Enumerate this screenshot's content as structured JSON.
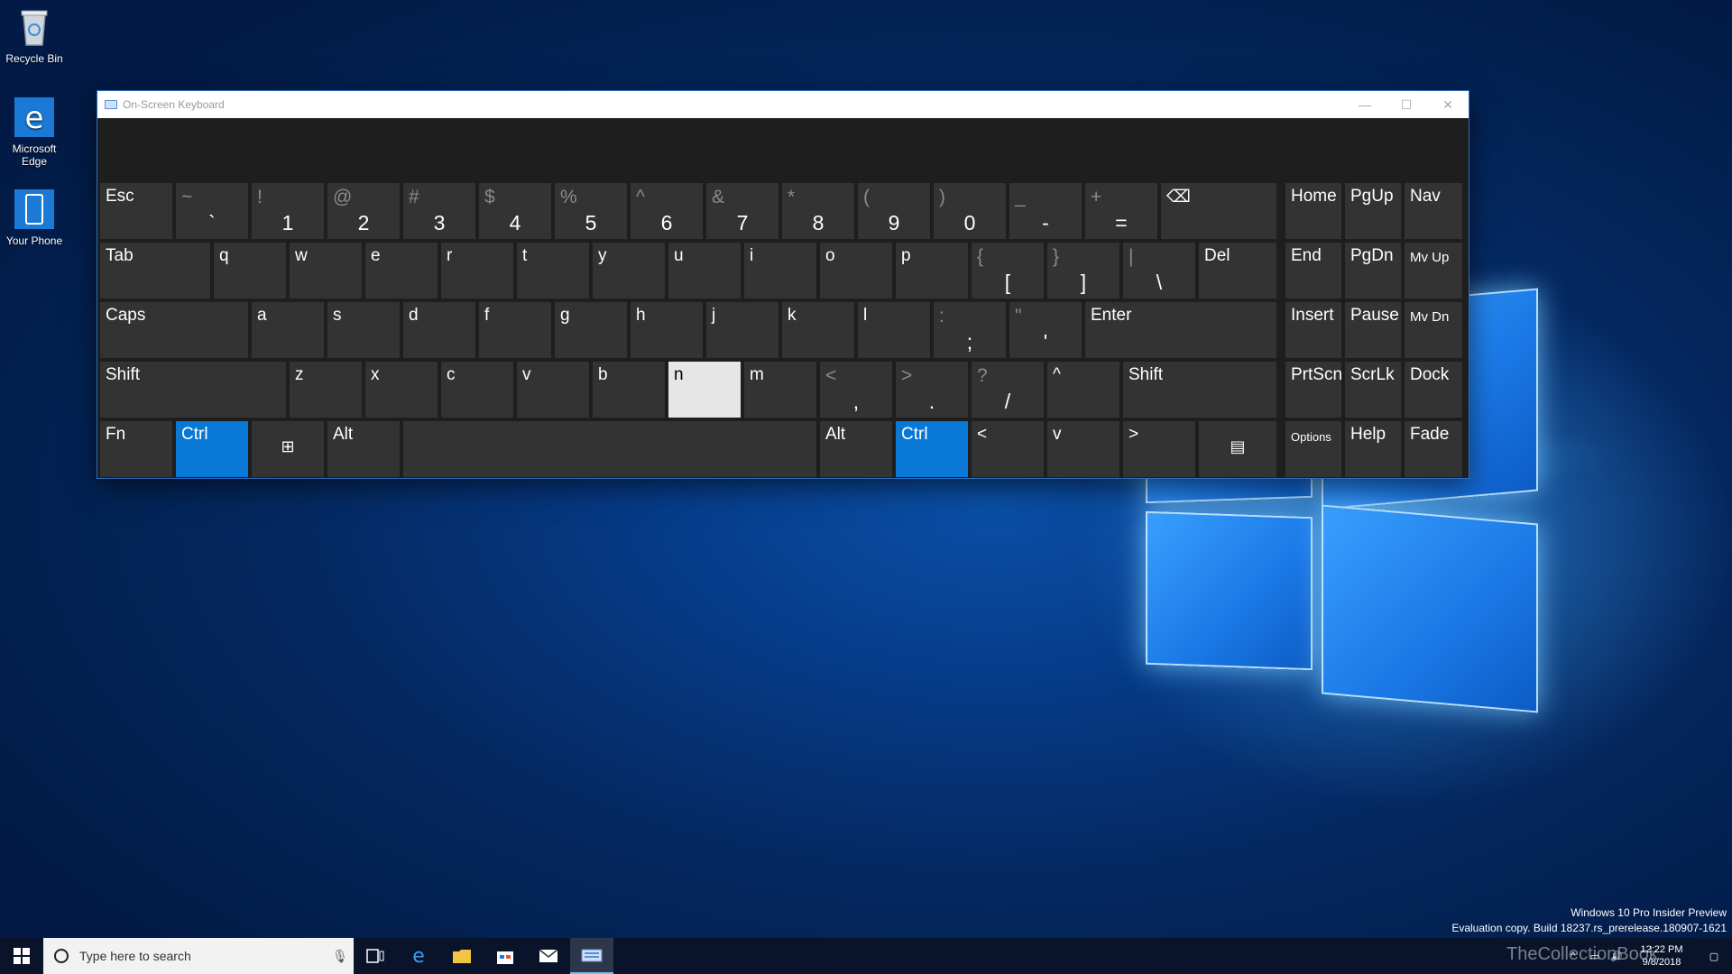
{
  "desktop": {
    "icons": [
      {
        "label": "Recycle Bin",
        "icon": "recycle-bin-icon"
      },
      {
        "label": "Microsoft Edge",
        "icon": "edge-icon"
      },
      {
        "label": "Your Phone",
        "icon": "phone-icon"
      }
    ]
  },
  "osk": {
    "title": "On-Screen Keyboard",
    "controls": {
      "minimize": "—",
      "maximize": "☐",
      "close": "✕"
    },
    "rows": [
      [
        {
          "lbl": "Esc"
        },
        {
          "top": "~",
          "bot": "`"
        },
        {
          "top": "!",
          "bot": "1"
        },
        {
          "top": "@",
          "bot": "2"
        },
        {
          "top": "#",
          "bot": "3"
        },
        {
          "top": "$",
          "bot": "4"
        },
        {
          "top": "%",
          "bot": "5"
        },
        {
          "top": "^",
          "bot": "6"
        },
        {
          "top": "&",
          "bot": "7"
        },
        {
          "top": "*",
          "bot": "8"
        },
        {
          "top": "(",
          "bot": "9"
        },
        {
          "top": ")",
          "bot": "0"
        },
        {
          "top": "_",
          "bot": "-"
        },
        {
          "top": "+",
          "bot": "="
        },
        {
          "lbl": "⌫",
          "icon": "backspace-icon"
        },
        {
          "lbl": "Home"
        },
        {
          "lbl": "PgUp"
        },
        {
          "lbl": "Nav"
        }
      ],
      [
        {
          "lbl": "Tab"
        },
        {
          "lbl": "q"
        },
        {
          "lbl": "w"
        },
        {
          "lbl": "e"
        },
        {
          "lbl": "r"
        },
        {
          "lbl": "t"
        },
        {
          "lbl": "y"
        },
        {
          "lbl": "u"
        },
        {
          "lbl": "i"
        },
        {
          "lbl": "o"
        },
        {
          "lbl": "p"
        },
        {
          "top": "{",
          "bot": "["
        },
        {
          "top": "}",
          "bot": "]"
        },
        {
          "top": "|",
          "bot": "\\"
        },
        {
          "lbl": "Del"
        },
        {
          "lbl": "End"
        },
        {
          "lbl": "PgDn"
        },
        {
          "lbl": "Mv Up"
        }
      ],
      [
        {
          "lbl": "Caps"
        },
        {
          "lbl": "a"
        },
        {
          "lbl": "s"
        },
        {
          "lbl": "d"
        },
        {
          "lbl": "f"
        },
        {
          "lbl": "g"
        },
        {
          "lbl": "h"
        },
        {
          "lbl": "j"
        },
        {
          "lbl": "k"
        },
        {
          "lbl": "l"
        },
        {
          "top": ":",
          "bot": ";"
        },
        {
          "top": "\"",
          "bot": "'"
        },
        {
          "lbl": "Enter"
        },
        {
          "lbl": "Insert"
        },
        {
          "lbl": "Pause"
        },
        {
          "lbl": "Mv Dn"
        }
      ],
      [
        {
          "lbl": "Shift"
        },
        {
          "lbl": "z"
        },
        {
          "lbl": "x"
        },
        {
          "lbl": "c"
        },
        {
          "lbl": "v"
        },
        {
          "lbl": "b"
        },
        {
          "lbl": "n",
          "state": "pressed"
        },
        {
          "lbl": "m"
        },
        {
          "top": "<",
          "bot": ","
        },
        {
          "top": ">",
          "bot": "."
        },
        {
          "top": "?",
          "bot": "/"
        },
        {
          "lbl": "^",
          "icon": "arrow-up-icon"
        },
        {
          "lbl": "Shift"
        },
        {
          "lbl": "PrtScn"
        },
        {
          "lbl": "ScrLk"
        },
        {
          "lbl": "Dock"
        }
      ],
      [
        {
          "lbl": "Fn"
        },
        {
          "lbl": "Ctrl",
          "state": "active"
        },
        {
          "lbl": "⊞",
          "icon": "windows-key-icon"
        },
        {
          "lbl": "Alt"
        },
        {
          "lbl": "",
          "icon": "spacebar"
        },
        {
          "lbl": "Alt"
        },
        {
          "lbl": "Ctrl",
          "state": "active"
        },
        {
          "lbl": "<",
          "icon": "arrow-left-icon"
        },
        {
          "lbl": "v",
          "icon": "arrow-down-icon"
        },
        {
          "lbl": ">",
          "icon": "arrow-right-icon"
        },
        {
          "lbl": "▤",
          "icon": "menu-key-icon"
        },
        {
          "lbl": "Options"
        },
        {
          "lbl": "Help"
        },
        {
          "lbl": "Fade"
        }
      ]
    ]
  },
  "taskbar": {
    "search_placeholder": "Type here to search",
    "pinned": [
      "task-view-icon",
      "edge-icon",
      "file-explorer-icon",
      "store-icon",
      "mail-icon",
      "osk-icon"
    ],
    "active_pinned": "osk-icon",
    "clock_time": "12:22 PM",
    "clock_date": "9/8/2018"
  },
  "watermark": {
    "line1": "Windows 10 Pro Insider Preview",
    "line2": "Evaluation copy. Build 18237.rs_prerelease.180907-1621"
  },
  "brand": "TheCollectionBook",
  "colors": {
    "accent": "#0a78d7",
    "key": "#333333",
    "pressed": "#e6e6e6"
  }
}
